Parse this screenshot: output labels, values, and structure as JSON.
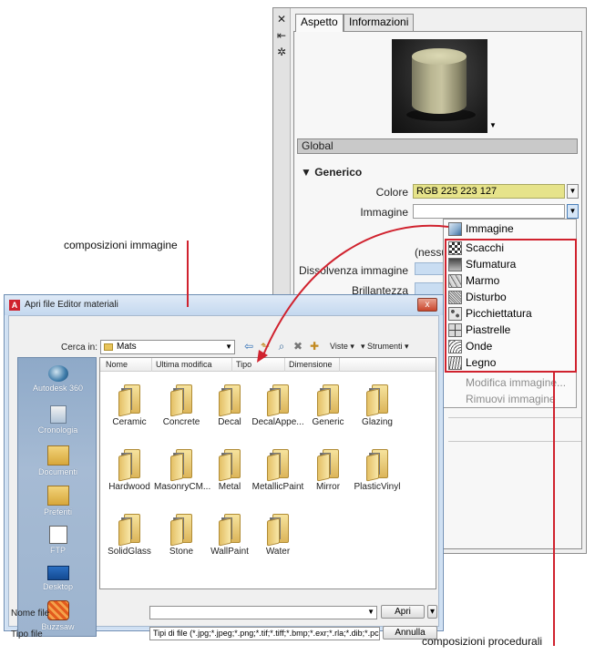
{
  "palette": {
    "tabs": [
      "Aspetto",
      "Informazioni"
    ],
    "side_icons": [
      "close-icon",
      "pin-icon",
      "properties-icon"
    ],
    "section": "Global",
    "group": "Generico",
    "props": {
      "color_label": "Colore",
      "color_value": "RGB 225 223 127",
      "image_label": "Immagine",
      "none_text": "(nessu",
      "fade_label": "Dissolvenza immagine",
      "gloss_label": "Brillantezza"
    },
    "menu": {
      "items": [
        "Immagine",
        "Scacchi",
        "Sfumatura",
        "Marmo",
        "Disturbo",
        "Picchiettatura",
        "Piastrelle",
        "Onde",
        "Legno"
      ],
      "disabled": [
        "Modifica immagine...",
        "Rimuovi immagine"
      ]
    },
    "accent_color": "#E1DF7F"
  },
  "dialog": {
    "title": "Apri file Editor materiali",
    "close": "x",
    "look_in_label": "Cerca in:",
    "look_in_value": "Mats",
    "toolbar": {
      "view": "Viste",
      "tools": "Strumenti"
    },
    "places": [
      "Autodesk 360",
      "Cronologia",
      "Documenti",
      "Preferiti",
      "FTP",
      "Desktop",
      "Buzzsaw"
    ],
    "columns": [
      "Nome",
      "Ultima modifica",
      "Tipo",
      "Dimensione"
    ],
    "files": [
      "Ceramic",
      "Concrete",
      "Decal",
      "DecalAppe...",
      "Generic",
      "Glazing",
      "Hardwood",
      "MasonryCM...",
      "Metal",
      "MetallicPaint",
      "Mirror",
      "PlasticVinyl",
      "SolidGlass",
      "Stone",
      "WallPaint",
      "Water"
    ],
    "filename_label": "Nome file",
    "filename_value": "",
    "filetype_label": "Tipo file",
    "filetype_value": "Tipi di file (*.jpg;*.jpeg;*.png;*.tif;*.tiff;*.bmp;*.exr;*.rla;*.dib;*.pcx;*.tga)",
    "open_button": "Apri",
    "cancel_button": "Annulla"
  },
  "annotations": {
    "image_compositions": "composizioni immagine",
    "procedural_compositions": "composizioni procedurali"
  },
  "highlight_color": "#D0222E"
}
